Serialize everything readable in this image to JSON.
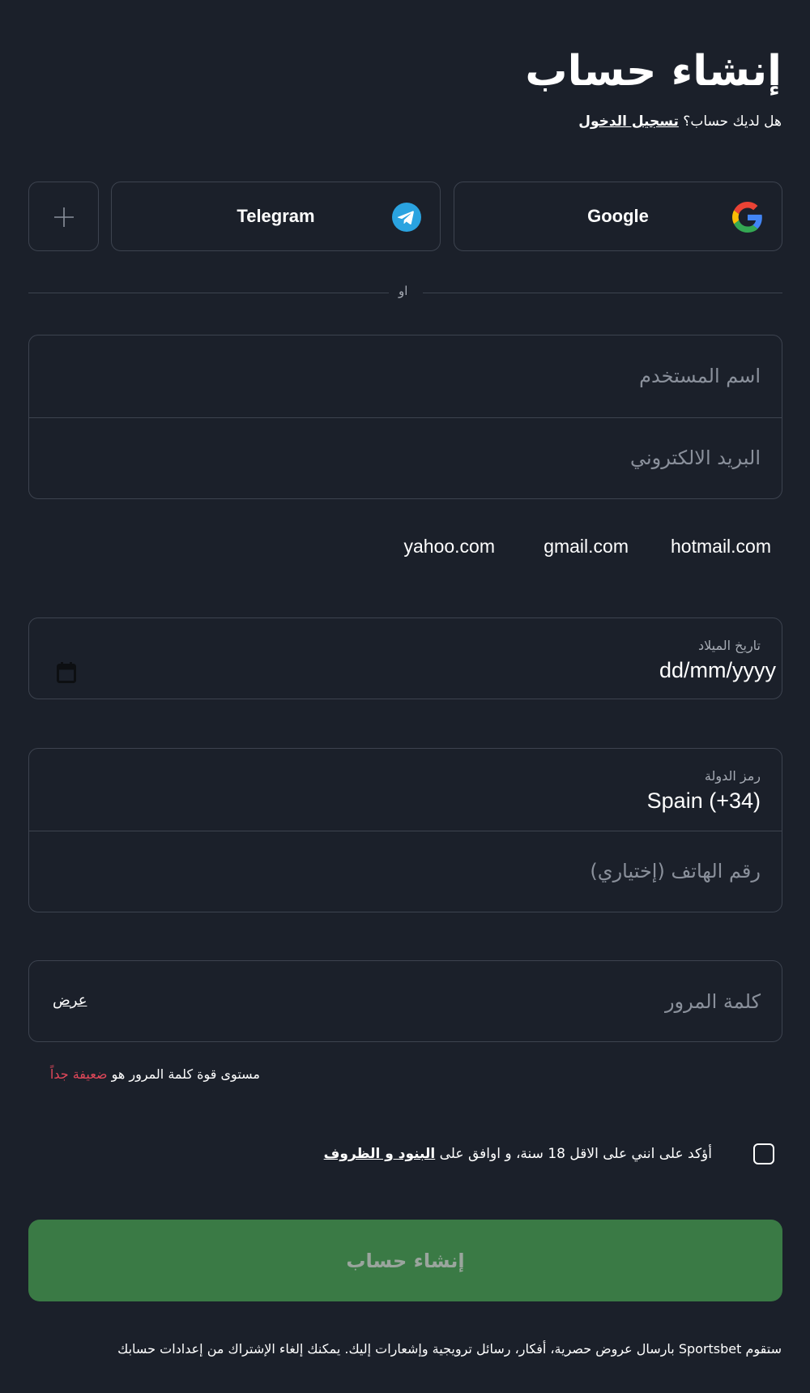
{
  "header": {
    "title": "إنشاء حساب",
    "have_account": "هل لديك حساب؟",
    "login_link": "تسجيل الدخول"
  },
  "social": {
    "google": "Google",
    "telegram": "Telegram",
    "more_icon": "plus-icon"
  },
  "divider": {
    "or": "او"
  },
  "fields": {
    "username_placeholder": "اسم المستخدم",
    "email_placeholder": "البريد الالكتروني"
  },
  "email_suggestions": [
    "hotmail.com",
    "gmail.com",
    "yahoo.com"
  ],
  "birthdate": {
    "label": "تاريخ الميلاد",
    "value": "dd/mm/yyyy"
  },
  "phone": {
    "country_label": "رمز الدولة",
    "country_value": "Spain (+34)",
    "phone_placeholder": "رقم الهاتف (إختياري)"
  },
  "password": {
    "placeholder": "كلمة المرور",
    "show": "عرض",
    "strength_text": "مستوى قوة كلمة المرور هو",
    "strength_value": "ضعيفة جداً"
  },
  "terms": {
    "text": "أؤكد على انني على الاقل 18 سنة، و اوافق على",
    "link": "البنود و الظروف"
  },
  "cta": {
    "label": "إنشاء حساب"
  },
  "footer": {
    "notice": "ستقوم Sportsbet بارسال عروض حصرية، أفكار، رسائل ترويجية وإشعارات إليك. يمكنك إلغاء الإشتراك من إعدادات حسابك"
  },
  "colors": {
    "background": "#1b202a",
    "border": "#3d434f",
    "cta": "#3a7a45",
    "weak": "#e2485a",
    "telegram": "#2aa3e0"
  }
}
